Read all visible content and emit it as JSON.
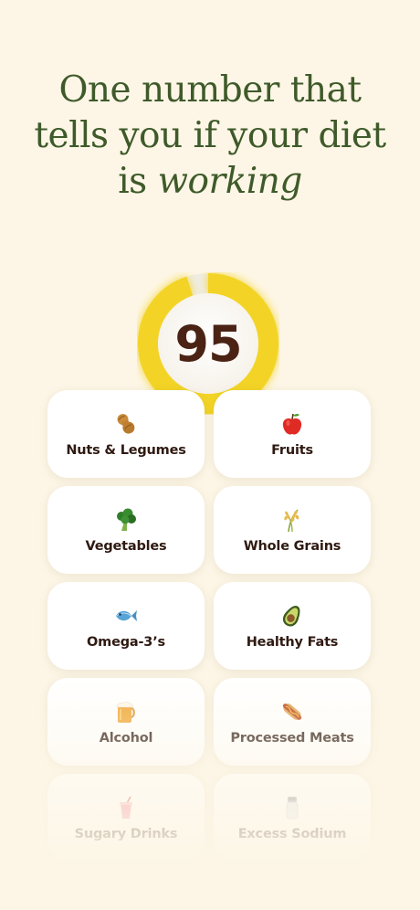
{
  "headline": {
    "line1": "One number that",
    "line2": "tells you if your diet",
    "line3_plain": "is ",
    "line3_italic": "working"
  },
  "score": {
    "value": "95",
    "progress": 0.95,
    "ring_color": "#f3d426",
    "track_color": "#efece4"
  },
  "categories": [
    {
      "label": "Nuts & Legumes",
      "icon": "peanut-icon"
    },
    {
      "label": "Fruits",
      "icon": "apple-icon"
    },
    {
      "label": "Vegetables",
      "icon": "broccoli-icon"
    },
    {
      "label": "Whole Grains",
      "icon": "rice-stalk-icon"
    },
    {
      "label": "Omega-3’s",
      "icon": "fish-icon"
    },
    {
      "label": "Healthy Fats",
      "icon": "avocado-icon"
    },
    {
      "label": "Alcohol",
      "icon": "beer-mug-icon"
    },
    {
      "label": "Processed Meats",
      "icon": "hot-dog-icon"
    },
    {
      "label": "Sugary Drinks",
      "icon": "cup-with-straw-icon"
    },
    {
      "label": "Excess Sodium",
      "icon": "salt-shaker-icon"
    }
  ],
  "colors": {
    "background": "#fdf6e6",
    "headline": "#3f5a2a",
    "score_text": "#4a2314",
    "card_text": "#2f1a12"
  }
}
